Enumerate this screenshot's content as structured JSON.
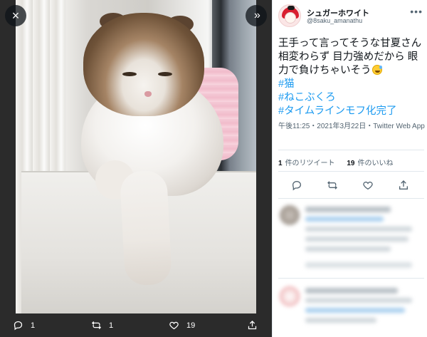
{
  "viewer": {
    "close_icon": "×",
    "next_icon": "»",
    "photo_actions": {
      "reply_count": "1",
      "retweet_count": "1",
      "like_count": "19"
    }
  },
  "tweet": {
    "display_name": "シュガーホワイト",
    "handle": "@8saku_amanathu",
    "text": "王手って言ってそうな甘夏さん 相変わらず 目力強めだから 眼力で負けちゃいそう",
    "hashtags": [
      "#猫",
      "#ねこぶくろ",
      "#タイムラインモフ化完了"
    ],
    "meta": "午後11:25・2021年3月22日・Twitter Web App",
    "retweets": {
      "count": "1",
      "label": "件のリツイート"
    },
    "likes": {
      "count": "19",
      "label": "件のいいね"
    }
  },
  "colors": {
    "link": "#1d9bf0",
    "text": "#0f1419",
    "secondary": "#536471",
    "viewer_bg": "#2b2b2b"
  }
}
